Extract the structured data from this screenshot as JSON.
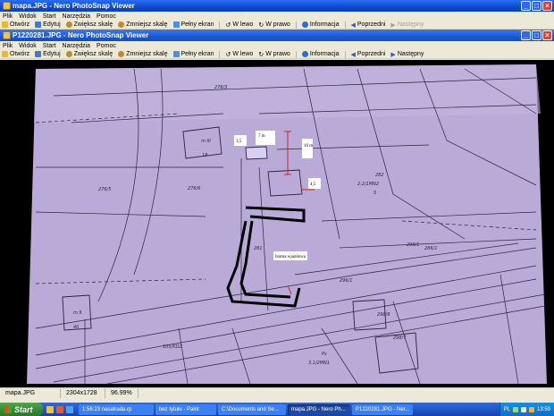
{
  "outer_window": {
    "title": "mapa.JPG - Nero PhotoSnap Viewer",
    "menu": [
      "Plik",
      "Widok",
      "Start",
      "Narzędzia",
      "Pomoc"
    ],
    "toolbar": {
      "open": "Otwórz",
      "edit": "Edytuj",
      "zoom_in": "Zwiększ skalę",
      "zoom_out": "Zmniejsz skalę",
      "fullscreen": "Pełny ekran",
      "rotate_left": "W lewo",
      "rotate_right": "W prawo",
      "info": "Informacja",
      "prev": "Poprzedni",
      "next": "Następny"
    }
  },
  "inner_window": {
    "title": "P1220281.JPG - Nero PhotoSnap Viewer",
    "menu": [
      "Plik",
      "Widok",
      "Start",
      "Narzędzia",
      "Pomoc"
    ],
    "toolbar": {
      "open": "Otwórz",
      "edit": "Edytuj",
      "zoom_in": "Zwiększ skalę",
      "zoom_out": "Zmniejsz skalę",
      "fullscreen": "Pełny ekran",
      "rotate_left": "W lewo",
      "rotate_right": "W prawo",
      "info": "Informacja",
      "prev": "Poprzedni",
      "next": "Następny"
    }
  },
  "map": {
    "labels": {
      "dim1": "3,5",
      "dim2": "7 m",
      "dim3": "16 m",
      "dim4": "4,5",
      "gate": "brama wjazdowa"
    },
    "parcels": [
      "276/3",
      "276/5",
      "276/6",
      "2.2/1MN2",
      "281",
      "298/1",
      "298/9",
      "298/7",
      "296/1",
      "105/KDZ",
      "3.1/2MN1",
      "18",
      "40",
      "m III",
      "m II",
      "S",
      "Ps",
      "282",
      "286/1"
    ],
    "paper_color": "#b7a8d6",
    "line_color": "#2a2440"
  },
  "statusbar": {
    "filename": "mapa.JPG",
    "dimensions": "2304x1728",
    "zoom": "96.99%"
  },
  "taskbar": {
    "start": "Start",
    "tasks": [
      "1:56:23 nasatrada.rp",
      "bez tytułu - Paint",
      "C:\\Documents and Se...",
      "mapa.JPG - Nero Ph...",
      "P1220281.JPG - Ner..."
    ],
    "lang": "PL",
    "clock": "13:59"
  }
}
